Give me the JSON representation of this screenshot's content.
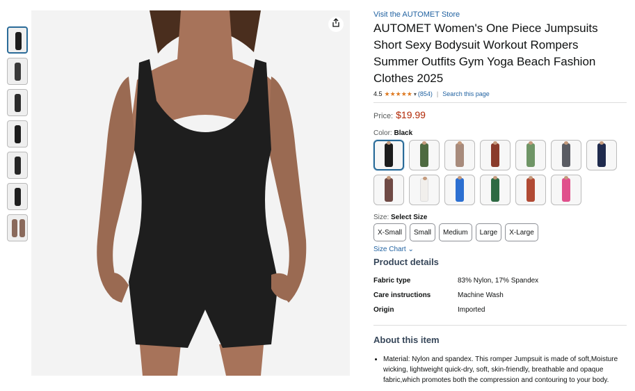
{
  "product": {
    "store_link": "Visit the AUTOMET Store",
    "title": "AUTOMET Women's One Piece Jumpsuits Short Sexy Bodysuit Workout Rompers Summer Outfits Gym Yoga Beach Fashion Clothes 2025",
    "rating_value": "4.5",
    "rating_stars": "★★★★★",
    "rating_count": "(854)",
    "search_page": "Search this page",
    "price_label": "Price:",
    "price": "$19.99"
  },
  "colors": {
    "label": "Color:",
    "selected": "Black",
    "swatches": [
      {
        "color": "#1c1c1c"
      },
      {
        "color": "#4e6a40"
      },
      {
        "color": "#a88b7c"
      },
      {
        "color": "#8a3b2b"
      },
      {
        "color": "#6f9566"
      },
      {
        "color": "#5a5c63"
      },
      {
        "color": "#1f2a4d"
      },
      {
        "color": "#6f4a45"
      },
      {
        "color": "#f1efec"
      },
      {
        "color": "#2c6fd1"
      },
      {
        "color": "#2e6a43"
      },
      {
        "color": "#b14a34"
      },
      {
        "color": "#e0508c"
      }
    ]
  },
  "sizes": {
    "label": "Size:",
    "selected": "Select Size",
    "options": [
      "X-Small",
      "Small",
      "Medium",
      "Large",
      "X-Large"
    ],
    "chart_link": "Size Chart"
  },
  "details": {
    "heading": "Product details",
    "rows": [
      {
        "key": "Fabric type",
        "value": "83% Nylon, 17% Spandex"
      },
      {
        "key": "Care instructions",
        "value": "Machine Wash"
      },
      {
        "key": "Origin",
        "value": "Imported"
      }
    ]
  },
  "about": {
    "heading": "About this item",
    "bullets": [
      "Material: Nylon and spandex. This romper Jumpsuit is made of soft,Moisture wicking, lightweight quick-dry, soft, skin-friendly, breathable and opaque fabric,which promotes both the compression and contouring to your body."
    ]
  },
  "thumbnails": [
    {
      "color": "#1c1c1c"
    },
    {
      "color": "#3a3a3a"
    },
    {
      "color": "#2b2b2b"
    },
    {
      "color": "#1c1c1c"
    },
    {
      "color": "#262626"
    },
    {
      "color": "#1f1f1f"
    },
    {
      "color": "#8a6a5c"
    }
  ],
  "icons": {
    "share": "share-icon",
    "dropdown": "chevron-down-icon"
  }
}
